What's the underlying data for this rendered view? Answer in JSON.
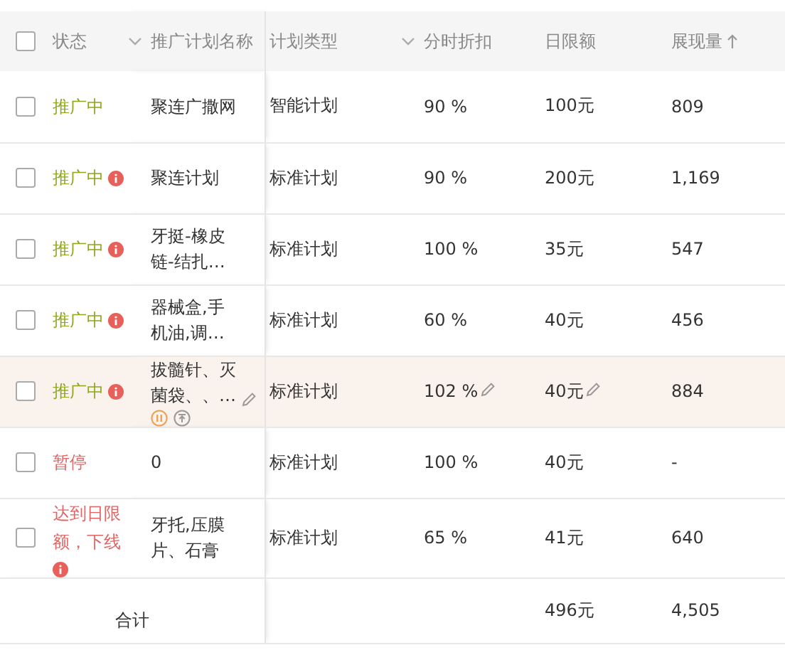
{
  "table": {
    "header_checked": false,
    "columns": [
      {
        "label": "状态",
        "dropdown": false,
        "sorted": false
      },
      {
        "label": "推广计划名称",
        "dropdown": true,
        "sorted": false
      },
      {
        "label": "计划类型",
        "dropdown": false,
        "sorted": false
      },
      {
        "label": "分时折扣",
        "dropdown": true,
        "sorted": false
      },
      {
        "label": "日限额",
        "dropdown": false,
        "sorted": false
      },
      {
        "label": "展现量",
        "dropdown": false,
        "sorted": true
      }
    ],
    "rows": [
      {
        "checked": false,
        "highlighted": false,
        "status": "推广中",
        "color": "#8fa81e",
        "warning": false,
        "name": "聚连广撒网",
        "name_editable": false,
        "type": "智能计划",
        "discount": "90 %",
        "discount_editable": false,
        "limit": "100元",
        "limit_editable": false,
        "impressions": "809"
      },
      {
        "checked": false,
        "highlighted": false,
        "status": "推广中",
        "color": "#8fa81e",
        "warning": true,
        "name": "聚连计划",
        "name_editable": false,
        "type": "标准计划",
        "discount": "90 %",
        "discount_editable": false,
        "limit": "200元",
        "limit_editable": false,
        "impressions": "1,169"
      },
      {
        "checked": false,
        "highlighted": false,
        "status": "推广中",
        "color": "#8fa81e",
        "warning": true,
        "name": "牙挺-橡皮链-结扎…",
        "name_editable": false,
        "type": "标准计划",
        "discount": "100 %",
        "discount_editable": false,
        "limit": "35元",
        "limit_editable": false,
        "impressions": "547"
      },
      {
        "checked": false,
        "highlighted": false,
        "status": "推广中",
        "color": "#8fa81e",
        "warning": true,
        "name": "器械盒,手机油,调…",
        "name_editable": false,
        "type": "标准计划",
        "discount": "60 %",
        "discount_editable": false,
        "limit": "40元",
        "limit_editable": false,
        "impressions": "456"
      },
      {
        "checked": false,
        "highlighted": true,
        "status": "推广中",
        "color": "#8fa81e",
        "warning": true,
        "name": "拔髓针、灭菌袋、、…",
        "name_editable": true,
        "badges": [
          {
            "kind": "paused"
          },
          {
            "kind": "top"
          }
        ],
        "type": "标准计划",
        "discount": "102 %",
        "discount_editable": true,
        "limit": "40元",
        "limit_editable": true,
        "impressions": "884"
      },
      {
        "checked": false,
        "highlighted": false,
        "status": "暂停",
        "color": "#e06666",
        "warning": false,
        "name": "0",
        "name_editable": false,
        "type": "标准计划",
        "discount": "100 %",
        "discount_editable": false,
        "limit": "40元",
        "limit_editable": false,
        "impressions": "-"
      },
      {
        "checked": false,
        "highlighted": false,
        "status": "达到日限额，下线",
        "color": "#e06666",
        "warning": true,
        "name": "牙托,压膜片、石膏",
        "name_editable": false,
        "type": "标准计划",
        "discount": "65 %",
        "discount_editable": false,
        "limit": "41元",
        "limit_editable": false,
        "impressions": "640"
      }
    ],
    "total": {
      "label": "合计",
      "limit": "496元",
      "impressions": "4,505"
    }
  }
}
